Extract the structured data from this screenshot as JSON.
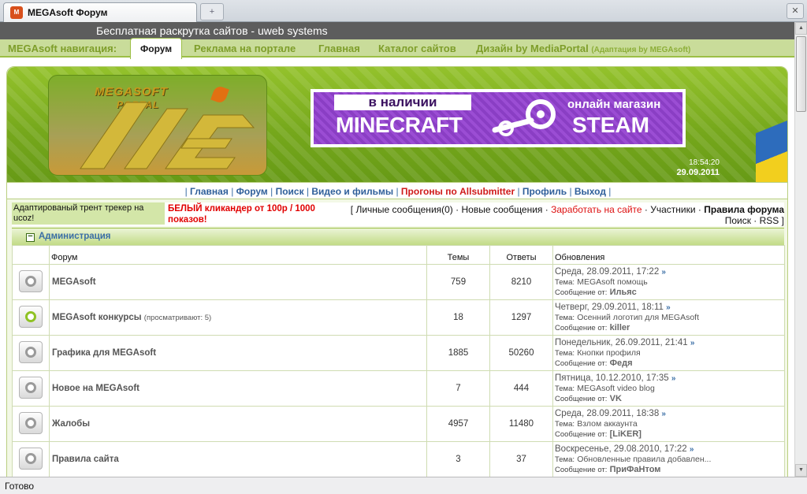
{
  "browser": {
    "tab_icon": "site-icon",
    "tab_title": "MEGAsoft Форум",
    "new_tab_glyph": "+",
    "status": "Готово"
  },
  "promo": "Бесплатная раскрутка сайтов - uweb systems",
  "nav": {
    "label": "MEGAsoft навигация:",
    "active": "Форум",
    "items": [
      "Реклама на портале",
      "Главная",
      "Каталог сайтов",
      "Дизайн by MediaPortal"
    ],
    "design_note": "(Адаптация by MEGAsoft)"
  },
  "header": {
    "logo_line1": "MEGASOFT",
    "logo_line2": "PORTAL",
    "banner_top": "в наличии",
    "banner_main": "MINECRAFT",
    "banner_right_top": "онлайн магазин",
    "banner_right_main": "STEAM",
    "time": "18:54:20",
    "date": "29.09.2011"
  },
  "menu": [
    "Главная",
    "Форум",
    "Поиск",
    "Видео и фильмы",
    "Прогоны по Allsubmitter",
    "Профиль",
    "Выход"
  ],
  "notices": {
    "left": "Адаптированый трент трекер на ucoz!",
    "middle": "БЕЛЫЙ кликандер от 100р / 1000 показов!"
  },
  "userlinks": {
    "messages": "Личные сообщения(0)",
    "new_posts": "Новые сообщения",
    "earn": "Заработать на сайте",
    "members": "Участники",
    "rules": "Правила форума",
    "search": "Поиск",
    "rss": "RSS"
  },
  "section": {
    "title": "Администрация",
    "collapse_glyph": "−"
  },
  "table": {
    "col_forum": "Форум",
    "col_topics": "Темы",
    "col_replies": "Ответы",
    "col_updates": "Обновления",
    "topic_label": "Тема:",
    "author_label": "Сообщение от:",
    "rows": [
      {
        "name": "MEGAsoft",
        "note": "",
        "topics": "759",
        "replies": "8210",
        "date": "Среда, 28.09.2011, 17:22",
        "topic": "MEGAsoft помощь",
        "author": "Ильяс",
        "new": false
      },
      {
        "name": "MEGAsoft конкурсы",
        "note": "(просматривают: 5)",
        "topics": "18",
        "replies": "1297",
        "date": "Четверг, 29.09.2011, 18:11",
        "topic": "Осенний логотип для MEGAsoft",
        "author": "killer",
        "new": true
      },
      {
        "name": "Графика для MEGAsoft",
        "note": "",
        "topics": "1885",
        "replies": "50260",
        "date": "Понедельник, 26.09.2011, 21:41",
        "topic": "Кнопки профиля",
        "author": "Федя",
        "new": false
      },
      {
        "name": "Новое на MEGAsoft",
        "note": "",
        "topics": "7",
        "replies": "444",
        "date": "Пятница, 10.12.2010, 17:35",
        "topic": "MEGAsoft video blog",
        "author": "VK",
        "new": false
      },
      {
        "name": "Жалобы",
        "note": "",
        "topics": "4957",
        "replies": "11480",
        "date": "Среда, 28.09.2011, 18:38",
        "topic": "Взлом аккаунта",
        "author": "[LiKER]",
        "new": false
      },
      {
        "name": "Правила сайта",
        "note": "",
        "topics": "3",
        "replies": "37",
        "date": "Воскресенье, 29.08.2010, 17:22",
        "topic": "Обновленные правила добавлен...",
        "author": "ПриФаНтом",
        "new": false
      }
    ]
  }
}
